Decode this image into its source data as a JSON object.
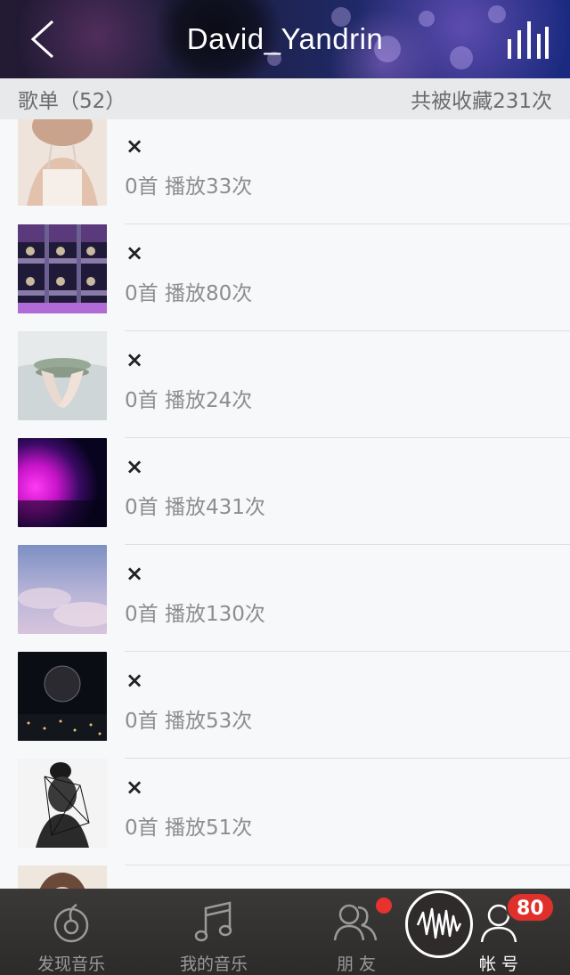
{
  "header": {
    "title": "David_Yandrin",
    "back_icon": "chevron-left-icon",
    "right_icon": "equalizer-bars-icon"
  },
  "section": {
    "left_label": "歌单（52）",
    "right_label": "共被收藏231次"
  },
  "playlists": [
    {
      "name": "×",
      "meta": "0首 播放33次",
      "cover_colors": [
        "#e9d7c8",
        "#c9a38c",
        "#f3ece7"
      ]
    },
    {
      "name": "×",
      "meta": "0首 播放80次",
      "cover_colors": [
        "#2a2146",
        "#6a3a7a",
        "#1c1a2c"
      ]
    },
    {
      "name": "×",
      "meta": "0首 播放24次",
      "cover_colors": [
        "#c9d2d6",
        "#a9b6ae",
        "#e4e8ea"
      ]
    },
    {
      "name": "×",
      "meta": "0首 播放431次",
      "cover_colors": [
        "#0a0626",
        "#d313d6",
        "#3b0a5c"
      ]
    },
    {
      "name": "×",
      "meta": "0首 播放130次",
      "cover_colors": [
        "#9aa6cc",
        "#c8b9d8",
        "#7f8fc0"
      ]
    },
    {
      "name": "×",
      "meta": "0首 播放53次",
      "cover_colors": [
        "#0b0d14",
        "#3a3020",
        "#1a1d2a"
      ]
    },
    {
      "name": "×",
      "meta": "0首 播放51次",
      "cover_colors": [
        "#d8d8d8",
        "#1a1a1a",
        "#f2f2f2"
      ]
    },
    {
      "name": "",
      "meta": "",
      "cover_colors": [
        "#e7d3c4",
        "#6b4a3a",
        "#f0e8e0"
      ]
    }
  ],
  "tabbar": {
    "tabs": [
      {
        "label": "发现音乐",
        "icon": "discover-music-icon",
        "active": false
      },
      {
        "label": "我的音乐",
        "icon": "music-note-icon",
        "active": false
      },
      {
        "label": "朋 友",
        "icon": "friends-icon",
        "active": false
      },
      {
        "label": "帐 号",
        "icon": "account-icon",
        "active": true
      }
    ],
    "player_icon": "now-playing-waveform-icon",
    "account_badge": "80"
  },
  "colors": {
    "accent_red": "#e0302c",
    "header_bg": "#1d1e3d",
    "section_bg": "#e8e9eb",
    "tabbar_bg": "#2d2a2a"
  }
}
